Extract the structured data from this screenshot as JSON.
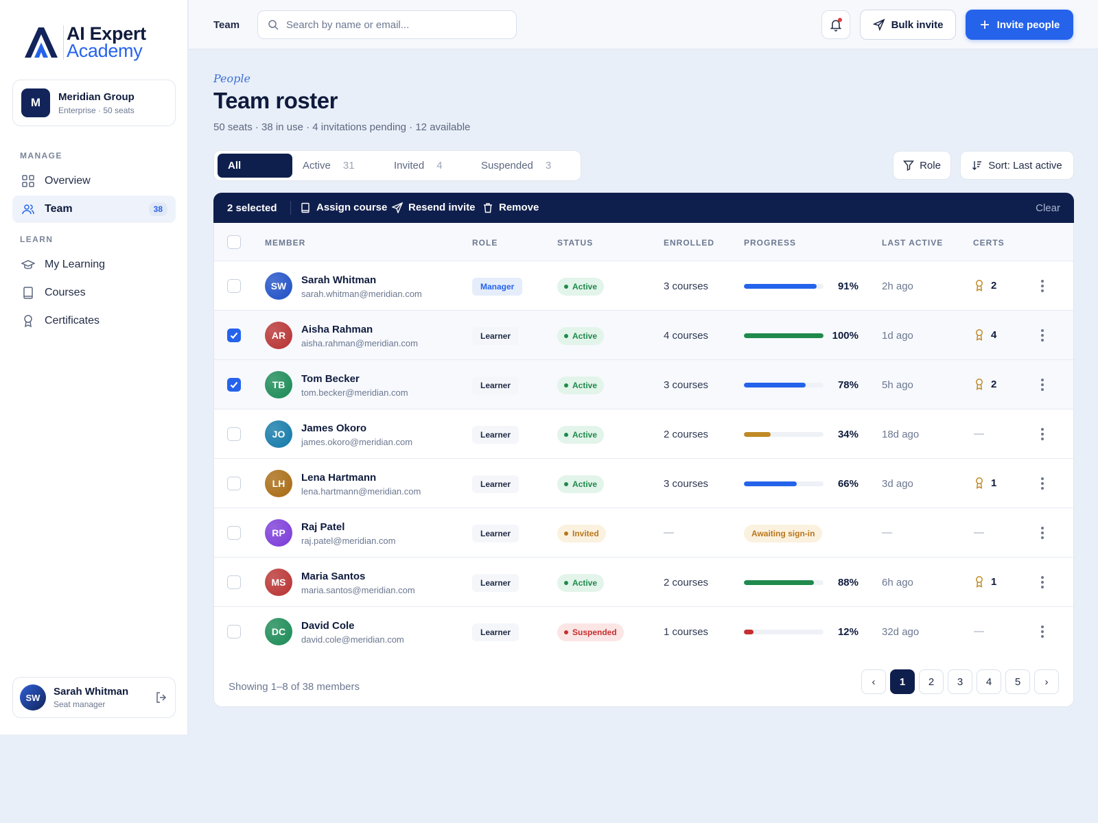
{
  "brand": {
    "line1": "AI Expert",
    "line2": "Academy"
  },
  "org": {
    "initial": "M",
    "name": "Meridian Group",
    "plan": "Enterprise · 50 seats"
  },
  "nav": {
    "manage_label": "MANAGE",
    "learn_label": "LEARN",
    "items": [
      {
        "label": "Overview",
        "icon": "grid-icon"
      },
      {
        "label": "Team",
        "icon": "users-icon",
        "badge": "38",
        "active": true
      },
      {
        "label": "My Learning",
        "icon": "graduation-cap-icon"
      },
      {
        "label": "Courses",
        "icon": "book-icon"
      },
      {
        "label": "Certificates",
        "icon": "award-icon"
      }
    ]
  },
  "current_user": {
    "initials": "SW",
    "name": "Sarah Whitman",
    "role": "Seat manager"
  },
  "topbar": {
    "breadcrumb": "Team",
    "search_placeholder": "Search by name or email...",
    "bulk_invite_label": "Bulk invite",
    "invite_label": "Invite people"
  },
  "header": {
    "eyebrow": "People",
    "title": "Team roster",
    "subtitle": "50 seats · 38 in use · 4 invitations pending · 12 available"
  },
  "tabs": [
    {
      "label": "All",
      "count": "",
      "active": true
    },
    {
      "label": "Active",
      "count": "31"
    },
    {
      "label": "Invited",
      "count": "4"
    },
    {
      "label": "Suspended",
      "count": "3"
    }
  ],
  "filters": {
    "role_label": "Role",
    "sort_label": "Sort: Last active"
  },
  "selection": {
    "count_label": "2 selected",
    "assign_label": "Assign course",
    "resend_label": "Resend invite",
    "remove_label": "Remove",
    "clear_label": "Clear"
  },
  "table": {
    "columns": [
      "MEMBER",
      "ROLE",
      "STATUS",
      "ENROLLED",
      "PROGRESS",
      "LAST ACTIVE",
      "CERTS"
    ],
    "rows": [
      {
        "initials": "SW",
        "name": "Sarah Whitman",
        "email": "sarah.whitman@meridian.com",
        "role": "Manager",
        "status": "Active",
        "enrolled": "3 courses",
        "progress": 91,
        "progress_label": "91%",
        "progress_color": "#2563eb",
        "last_active": "2h ago",
        "certs": "2",
        "selected": false,
        "avatar_color": "#1e4fc6"
      },
      {
        "initials": "AR",
        "name": "Aisha Rahman",
        "email": "aisha.rahman@meridian.com",
        "role": "Learner",
        "status": "Active",
        "enrolled": "4 courses",
        "progress": 100,
        "progress_label": "100%",
        "progress_color": "#1f8a4c",
        "last_active": "1d ago",
        "certs": "4",
        "selected": true,
        "avatar_color": "#b83232"
      },
      {
        "initials": "TB",
        "name": "Tom Becker",
        "email": "tom.becker@meridian.com",
        "role": "Learner",
        "status": "Active",
        "enrolled": "3 courses",
        "progress": 78,
        "progress_label": "78%",
        "progress_color": "#2563eb",
        "last_active": "5h ago",
        "certs": "2",
        "selected": true,
        "avatar_color": "#1a8a55"
      },
      {
        "initials": "JO",
        "name": "James Okoro",
        "email": "james.okoro@meridian.com",
        "role": "Learner",
        "status": "Active",
        "enrolled": "2 courses",
        "progress": 34,
        "progress_label": "34%",
        "progress_color": "#c08a26",
        "last_active": "18d ago",
        "certs": "—",
        "selected": false,
        "avatar_color": "#1279a8"
      },
      {
        "initials": "LH",
        "name": "Lena Hartmann",
        "email": "lena.hartmann@meridian.com",
        "role": "Learner",
        "status": "Active",
        "enrolled": "3 courses",
        "progress": 66,
        "progress_label": "66%",
        "progress_color": "#2563eb",
        "last_active": "3d ago",
        "certs": "1",
        "selected": false,
        "avatar_color": "#a86a12"
      },
      {
        "initials": "RP",
        "name": "Raj Patel",
        "email": "raj.patel@meridian.com",
        "role": "Learner",
        "status": "Invited",
        "enrolled": "—",
        "progress": null,
        "progress_label": "Awaiting sign-in",
        "progress_color": "",
        "last_active": "—",
        "certs": "—",
        "selected": false,
        "avatar_color": "#7b3ad8"
      },
      {
        "initials": "MS",
        "name": "Maria Santos",
        "email": "maria.santos@meridian.com",
        "role": "Learner",
        "status": "Active",
        "enrolled": "2 courses",
        "progress": 88,
        "progress_label": "88%",
        "progress_color": "#1f8a4c",
        "last_active": "6h ago",
        "certs": "1",
        "selected": false,
        "avatar_color": "#b83232"
      },
      {
        "initials": "DC",
        "name": "David Cole",
        "email": "david.cole@meridian.com",
        "role": "Learner",
        "status": "Suspended",
        "enrolled": "1 courses",
        "progress": 12,
        "progress_label": "12%",
        "progress_color": "#c62f2f",
        "last_active": "32d ago",
        "certs": "—",
        "selected": false,
        "avatar_color": "#1a8a55"
      }
    ]
  },
  "pagination": {
    "showing": "Showing 1–8 of 38 members",
    "prev": "‹",
    "next": "›",
    "pages": [
      "1",
      "2",
      "3",
      "4",
      "5"
    ],
    "current": "1"
  }
}
